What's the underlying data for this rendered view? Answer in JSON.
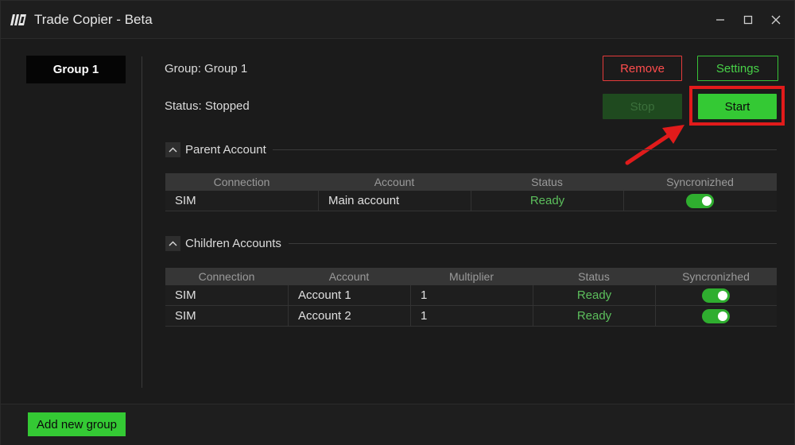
{
  "window": {
    "title": "Trade Copier - Beta",
    "controls": {
      "minimize": "—",
      "maximize": "☐",
      "close": "✕"
    }
  },
  "sidebar": {
    "groups": [
      {
        "label": "Group 1",
        "selected": true
      }
    ]
  },
  "main": {
    "group_text": "Group:  Group 1",
    "status_text": "Status: Stopped",
    "buttons": {
      "remove": "Remove",
      "settings": "Settings",
      "stop": "Stop",
      "start": "Start"
    },
    "parent_section": {
      "title": "Parent Account",
      "columns": [
        "Connection",
        "Account",
        "Status",
        "Syncronizhed"
      ],
      "rows": [
        {
          "connection": "SIM",
          "account": "Main account",
          "status": "Ready",
          "synchronized": true
        }
      ]
    },
    "children_section": {
      "title": "Children Accounts",
      "columns": [
        "Connection",
        "Account",
        "Multiplier",
        "Status",
        "Syncronizhed"
      ],
      "rows": [
        {
          "connection": "SIM",
          "account": "Account 1",
          "multiplier": "1",
          "status": "Ready",
          "synchronized": true
        },
        {
          "connection": "SIM",
          "account": "Account 2",
          "multiplier": "1",
          "status": "Ready",
          "synchronized": true
        }
      ]
    }
  },
  "footer": {
    "add_group": "Add new group"
  },
  "colors": {
    "accent_green": "#34c934",
    "danger_red": "#e53b3b",
    "annotation_red": "#e11b1b",
    "ready_green": "#5cbf5c"
  },
  "icons": {
    "app_logo": "app-logo-icon",
    "collapse": "chevron-up-icon"
  }
}
